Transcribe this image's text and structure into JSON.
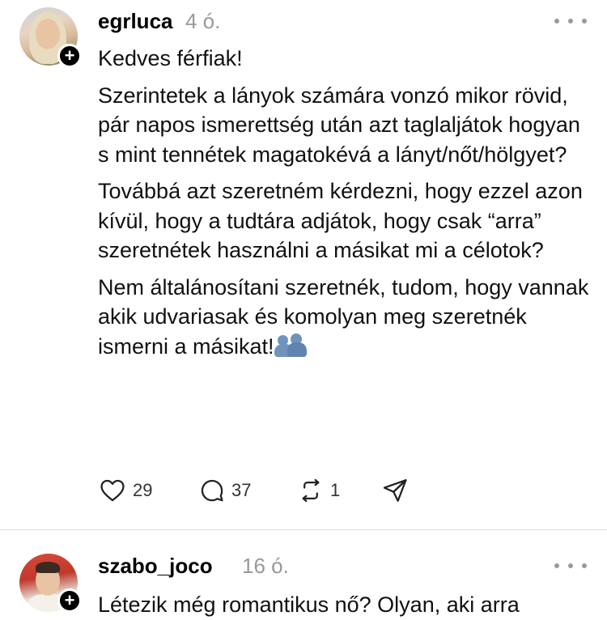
{
  "posts": [
    {
      "username": "egrluca",
      "time": "4 ó.",
      "paragraphs": [
        "Kedves férfiak!",
        "Szerintetek a lányok számára vonzó mikor rövid, pár napos ismerettség után azt taglaljátok hogyan s mint tennétek magatokévá a lányt/nőt/hölgyet?",
        "Továbbá azt szeretném kérdezni, hogy ezzel azon kívül, hogy a tudtára adjátok, hogy csak “arra” szeretnétek használni a másikat mi a célotok?",
        "Nem általánosítani szeretnék, tudom, hogy vannak akik udvariasak és komolyan meg szeretnék ismerni a másikat!"
      ],
      "emoji": "people-hugging-emoji",
      "likes": "29",
      "replies": "37",
      "reposts": "1"
    },
    {
      "username": "szabo_joco",
      "time": "16 ó.",
      "paragraphs": [
        "Létezik még romantikus nő? Olyan, aki arra"
      ]
    }
  ],
  "icons": {
    "like": "heart-icon",
    "reply": "comment-icon",
    "repost": "repost-icon",
    "share": "send-icon",
    "more": "more-icon",
    "follow": "plus-icon"
  },
  "colors": {
    "text": "#111111",
    "muted": "#999999",
    "divider": "#dcdcdc"
  }
}
